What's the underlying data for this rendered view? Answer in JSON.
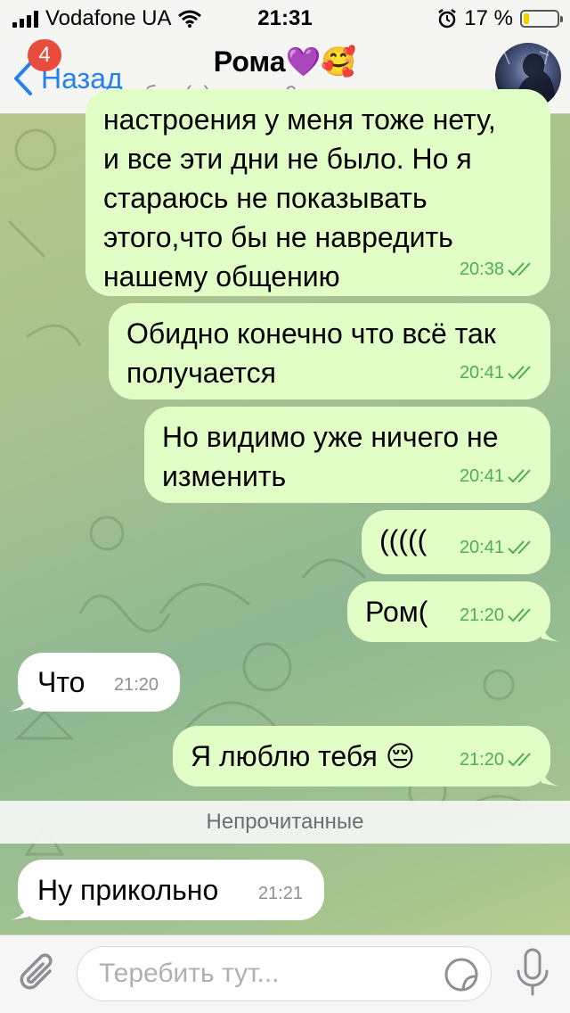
{
  "status": {
    "carrier": "Vodafone UA",
    "time": "21:31",
    "battery": "17 %",
    "battery_level": 0.17
  },
  "header": {
    "back_label": "Назад",
    "unread_badge": "4",
    "title": "Рома💜🥰",
    "last_seen": "был(а) на хуе 9 минут назад"
  },
  "messages": [
    {
      "dir": "out",
      "text": "настроения у меня тоже нету,\nи все эти дни не было. Но я\nстараюсь не показывать\nэтого,что бы не навредить\nнашему общению",
      "time": "20:38",
      "read": true
    },
    {
      "dir": "out",
      "text": "Обидно конечно что всё так\nполучается",
      "time": "20:41",
      "read": true
    },
    {
      "dir": "out",
      "text": "Но видимо уже ничего не\nизменить",
      "time": "20:41",
      "read": true
    },
    {
      "dir": "out",
      "text": "(((((",
      "time": "20:41",
      "read": true
    },
    {
      "dir": "out",
      "text": "Ром(",
      "time": "21:20",
      "read": true
    },
    {
      "dir": "in",
      "text": "Что",
      "time": "21:20"
    },
    {
      "dir": "out",
      "text": "Я люблю тебя 😔",
      "time": "21:20",
      "read": true
    },
    {
      "dir": "in",
      "text": "Ну прикольно",
      "time": "21:21"
    }
  ],
  "unread_divider": "Непрочитанные",
  "composer": {
    "placeholder": "Теребить тут..."
  },
  "colors": {
    "accent": "#2480ea",
    "outgoing_bubble": "#e1fec6",
    "incoming_bubble": "#ffffff",
    "check_color": "#4fae4e",
    "badge": "#e74c3c"
  },
  "icons": [
    "back-chevron-icon",
    "signal-icon",
    "wifi-icon",
    "alarm-icon",
    "battery-icon",
    "double-check-icon",
    "attach-icon",
    "sticker-icon",
    "mic-icon"
  ]
}
